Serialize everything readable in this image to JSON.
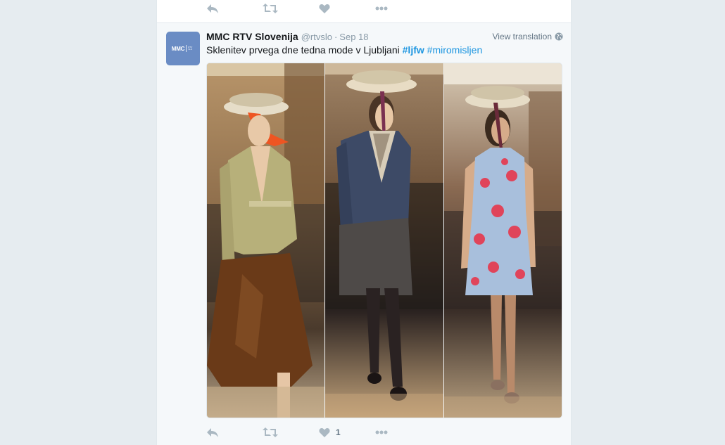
{
  "colors": {
    "background": "#e6ecf0",
    "card": "#ffffff",
    "tweet_highlight": "#f5f8fa",
    "link": "#1b95e0",
    "muted": "#8899a6",
    "icon": "#aab8c2",
    "avatar_bg": "#6a8cc4"
  },
  "previous_tweet": {
    "actions": [
      {
        "icon": "reply-icon",
        "count": ""
      },
      {
        "icon": "retweet-icon",
        "count": ""
      },
      {
        "icon": "heart-icon",
        "count": ""
      },
      {
        "icon": "more-icon",
        "count": ""
      }
    ]
  },
  "tweet": {
    "avatar_text": "MMC",
    "avatar_subtext": "RTV SLO",
    "fullname": "MMC RTV Slovenija",
    "username": "@rtvslo",
    "separator": "·",
    "time": "Sep 18",
    "view_translation": "View translation",
    "text": "Sklenitev prvega dne tedna mode v Ljubljani",
    "hashtags": [
      "#ljfw",
      "#miromisljen"
    ],
    "media": {
      "photos": [
        {
          "name": "model-olive-jacket-brown-skirt"
        },
        {
          "name": "model-denim-jacket-leopard-collar"
        },
        {
          "name": "model-floral-blue-dress"
        }
      ]
    },
    "actions": [
      {
        "icon": "reply-icon",
        "count": ""
      },
      {
        "icon": "retweet-icon",
        "count": ""
      },
      {
        "icon": "heart-icon",
        "count": "1"
      },
      {
        "icon": "more-icon",
        "count": ""
      }
    ]
  }
}
